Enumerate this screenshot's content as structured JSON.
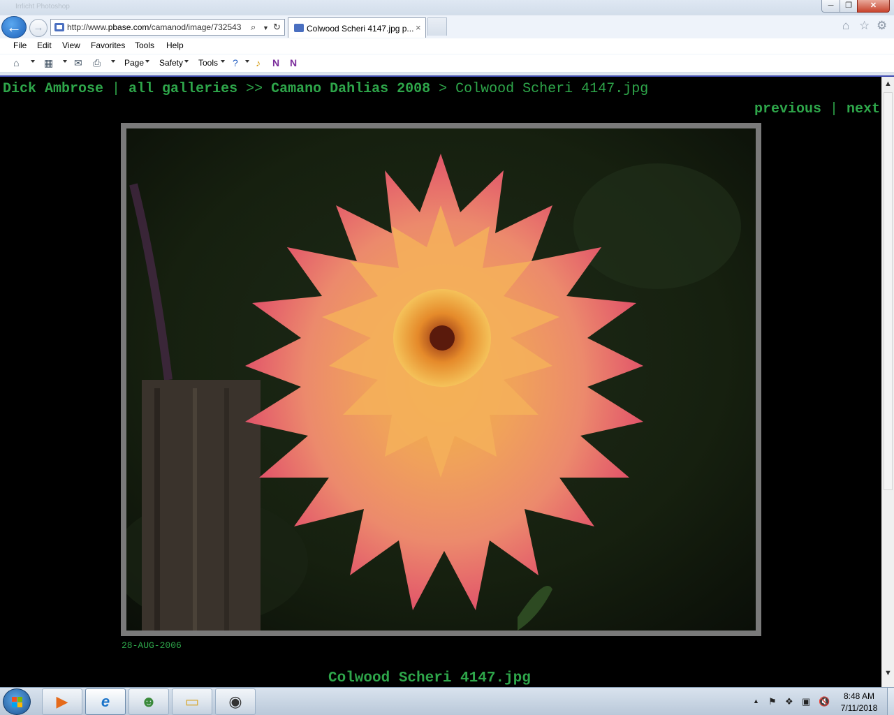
{
  "window": {
    "faded_title": "Irrlicht Photoshop",
    "controls": {
      "minimize": "─",
      "maximize": "❐",
      "close": "✕"
    }
  },
  "toolbar_nav": {
    "back_icon": "back-arrow-icon",
    "forward_icon": "forward-arrow-icon",
    "address_prefix": "http://www.",
    "address_domain": "pbase.com",
    "address_rest": "/camanod/image/732543",
    "tab_title": "Colwood Scheri 4147.jpg p...",
    "tab_close": "×"
  },
  "menubar": [
    "File",
    "Edit",
    "View",
    "Favorites",
    "Tools",
    "Help"
  ],
  "commandbar": {
    "page": "Page",
    "safety": "Safety",
    "tools": "Tools"
  },
  "page": {
    "breadcrumb": {
      "owner": "Dick Ambrose",
      "sep1": " | ",
      "all_galleries": "all galleries",
      "sep2": " >> ",
      "gallery": "Camano Dahlias 2008",
      "sep3": " > ",
      "current": "Colwood Scheri 4147.jpg"
    },
    "nav": {
      "previous": "previous",
      "sep": " | ",
      "next": "next"
    },
    "photo": {
      "date": "28-AUG-2006",
      "caption": "Colwood Scheri 4147.jpg"
    }
  },
  "taskbar": {
    "apps": [
      "media-player-icon",
      "internet-explorer-icon",
      "users-icon",
      "file-explorer-icon",
      "photo-viewer-icon"
    ],
    "clock_time": "8:48 AM",
    "clock_date": "7/11/2018"
  },
  "colors": {
    "link_green": "#2ea64a",
    "page_bg": "#000000",
    "frame_grey": "#7a7a7a"
  }
}
